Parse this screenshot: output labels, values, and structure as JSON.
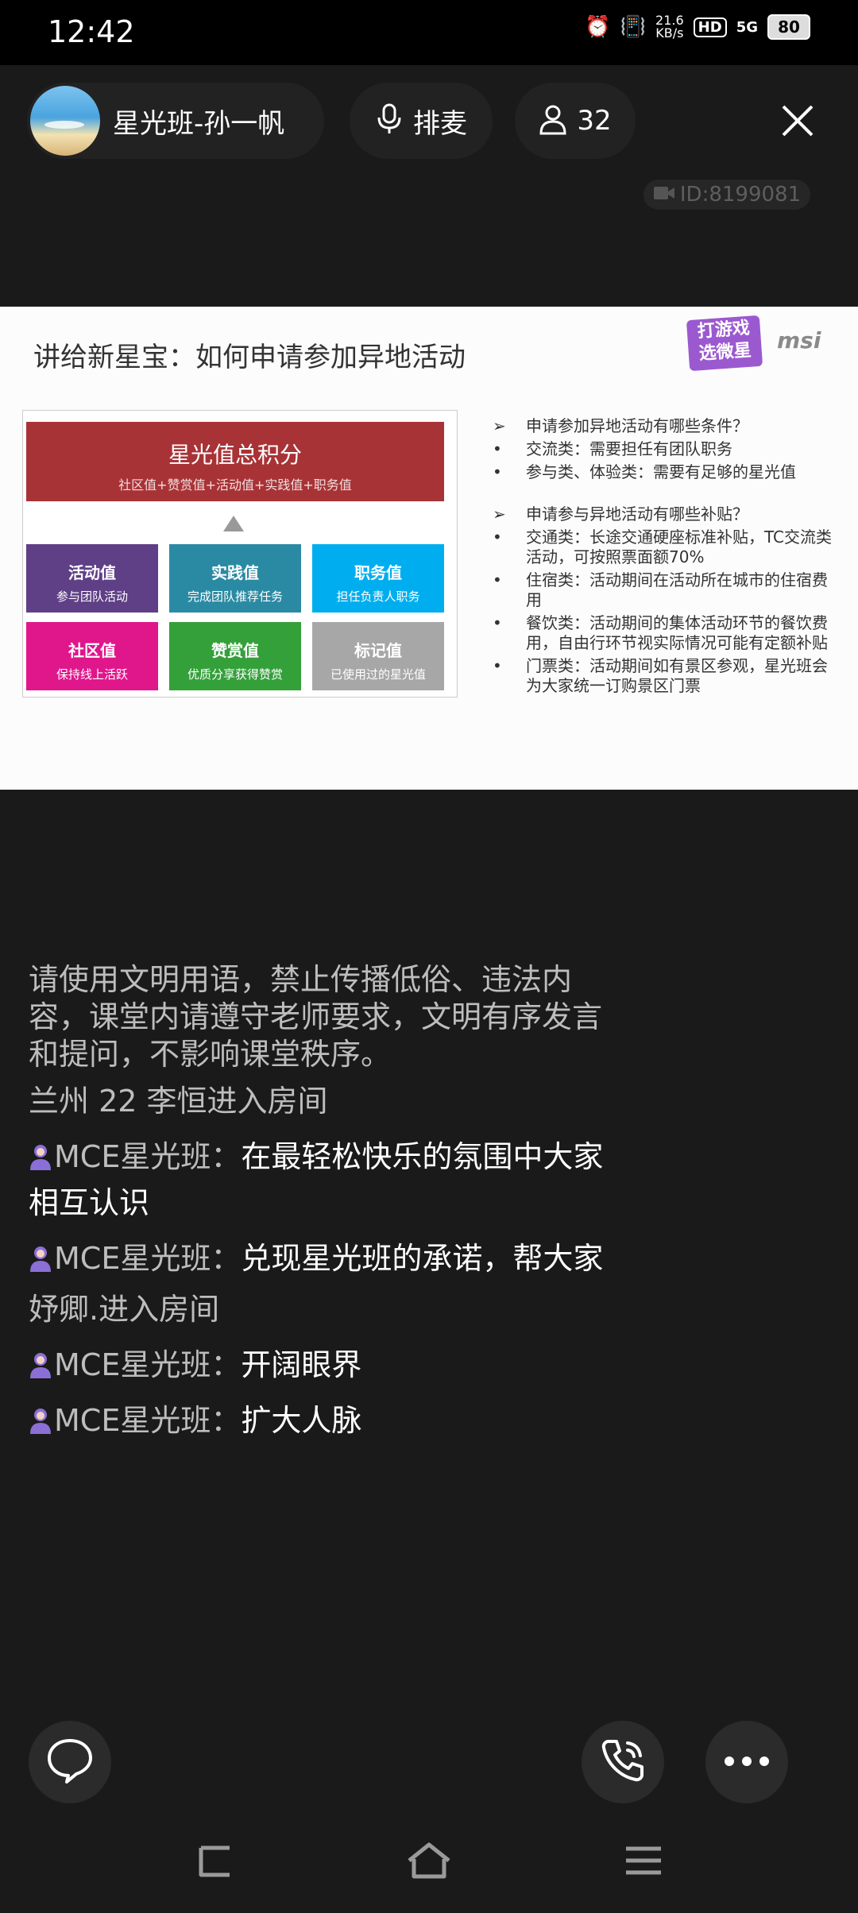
{
  "status_bar": {
    "time": "12:42",
    "net_speed_value": "21.6",
    "net_speed_unit": "KB/s",
    "hd_label": "HD",
    "signal_label": "5G",
    "battery": "80"
  },
  "room": {
    "name": "星光班-孙一帆",
    "mic_label": "排麦",
    "viewer_count": "32",
    "room_id": "ID:8199081"
  },
  "slide": {
    "title": "讲给新星宝：如何申请参加异地活动",
    "brand_line1": "打游戏",
    "brand_line2": "选微星",
    "brand_logo": "msi",
    "total": {
      "title": "星光值总积分",
      "formula": "社区值+赞赏值+活动值+实践值+职务值"
    },
    "cells": [
      {
        "title": "活动值",
        "desc": "参与团队活动",
        "color": "#5f3f86"
      },
      {
        "title": "实践值",
        "desc": "完成团队推荐任务",
        "color": "#2b8aa3"
      },
      {
        "title": "职务值",
        "desc": "担任负责人职务",
        "color": "#00aeef"
      },
      {
        "title": "社区值",
        "desc": "保持线上活跃",
        "color": "#e0168b"
      },
      {
        "title": "赞赏值",
        "desc": "优质分享获得赞赏",
        "color": "#34a03a"
      },
      {
        "title": "标记值",
        "desc": "已使用过的星光值",
        "color": "#a7a7a7"
      }
    ],
    "arrow_bullet": "➢",
    "dot_bullet": "•",
    "notes": [
      "申请参加异地活动有哪些条件？",
      "交流类：需要担任有团队职务",
      "参与类、体验类：需要有足够的星光值",
      "申请参与异地活动有哪些补贴？",
      "交通类：长途交通硬座标准补贴，TC交流类活动，可按照票面额70%",
      "住宿类：活动期间在活动所在城市的住宿费用",
      "餐饮类：活动期间的集体活动环节的餐饮费用，自由行环节视实际情况可能有定额补贴",
      "门票类：活动期间如有景区参观，星光班会为大家统一订购景区门票"
    ]
  },
  "chat": {
    "notice": "请使用文明用语，禁止传播低俗、违法内容，课堂内请遵守老师要求，文明有序发言和提问，不影响课堂秩序。",
    "join1": "兰州 22 李恒进入房间",
    "join2": "妤卿.进入房间",
    "messages": [
      {
        "sender": "MCE星光班：",
        "text": "在最轻松快乐的氛围中大家相互认识"
      },
      {
        "sender": "MCE星光班：",
        "text": "兑现星光班的承诺，帮大家"
      },
      {
        "sender": "MCE星光班：",
        "text": "开阔眼界"
      },
      {
        "sender": "MCE星光班：",
        "text": "扩大人脉"
      }
    ]
  },
  "icons": {
    "close": "close-icon",
    "mic": "mic-icon",
    "person": "person-icon",
    "camera": "camera-icon",
    "chat": "chat-bubble-icon",
    "phone": "phone-icon",
    "more": "more-dots-icon",
    "back": "back-icon",
    "home": "home-icon",
    "menu": "menu-icon"
  }
}
